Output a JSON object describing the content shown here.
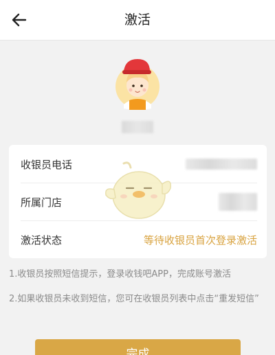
{
  "header": {
    "title": "激活",
    "back_icon": "arrow-left-icon"
  },
  "profile": {
    "avatar_icon": "cashier-avatar-icon"
  },
  "info": {
    "rows": [
      {
        "label": "收银员电话"
      },
      {
        "label": "所属门店"
      },
      {
        "label": "激活状态",
        "value": "等待收银员首次登录激活"
      }
    ]
  },
  "notes": {
    "line1": "1.收银员按照短信提示，登录收钱吧APP，完成账号激活",
    "line2": "2.如果收银员未收到短信，您可在收银员列表中点击“重发短信”"
  },
  "actions": {
    "done_label": "完成"
  },
  "colors": {
    "accent": "#d9a746",
    "status_text": "#d8a23e",
    "background": "#f2f2f2"
  }
}
